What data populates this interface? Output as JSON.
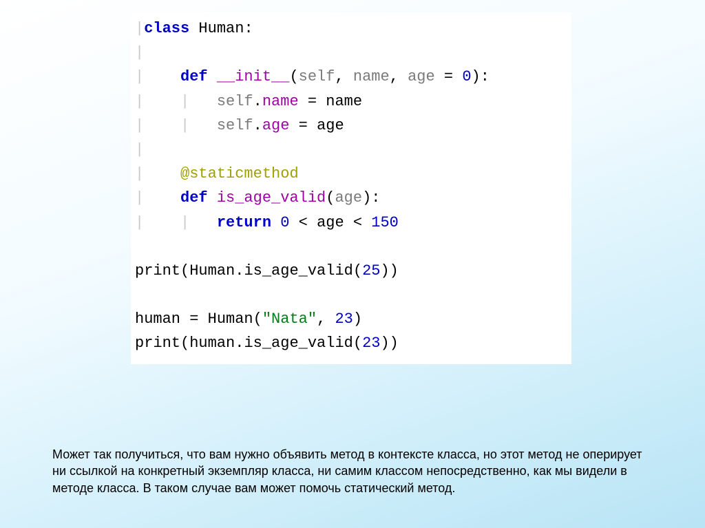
{
  "code": {
    "l1": {
      "kw1": "class",
      "name": "Human",
      "colon": ":"
    },
    "l3": {
      "kw": "def",
      "fname": "__init__",
      "p_self": "self",
      "p_name": "name",
      "p_age": "age",
      "eq": " = ",
      "zero": "0"
    },
    "l4": {
      "self": "self",
      "attr": "name",
      "eq": " = ",
      "rhs": "name"
    },
    "l5": {
      "self": "self",
      "attr": "age",
      "eq": " = ",
      "rhs": "age"
    },
    "l7": {
      "dec": "@staticmethod"
    },
    "l8": {
      "kw": "def",
      "fname": "is_age_valid",
      "p": "age"
    },
    "l9": {
      "kw": "return",
      "n0": "0",
      "lt1": " < ",
      "age": "age",
      "lt2": " < ",
      "n150": "150"
    },
    "l11": {
      "print": "print",
      "cls": "Human",
      "call": "is_age_valid",
      "arg": "25"
    },
    "l13": {
      "var": "human",
      "eq": " = ",
      "cls": "Human",
      "str": "\"Nata\"",
      "arg2": "23"
    },
    "l14": {
      "print": "print",
      "obj": "human",
      "call": "is_age_valid",
      "arg": "23"
    }
  },
  "paragraph": "Может так получиться, что вам нужно объявить метод в контексте класса, но этот метод не оперирует ни ссылкой на конкретный экземпляр класса, ни самим классом непосредственно, как мы видели в методе класса. В таком случае вам может помочь статический метод."
}
